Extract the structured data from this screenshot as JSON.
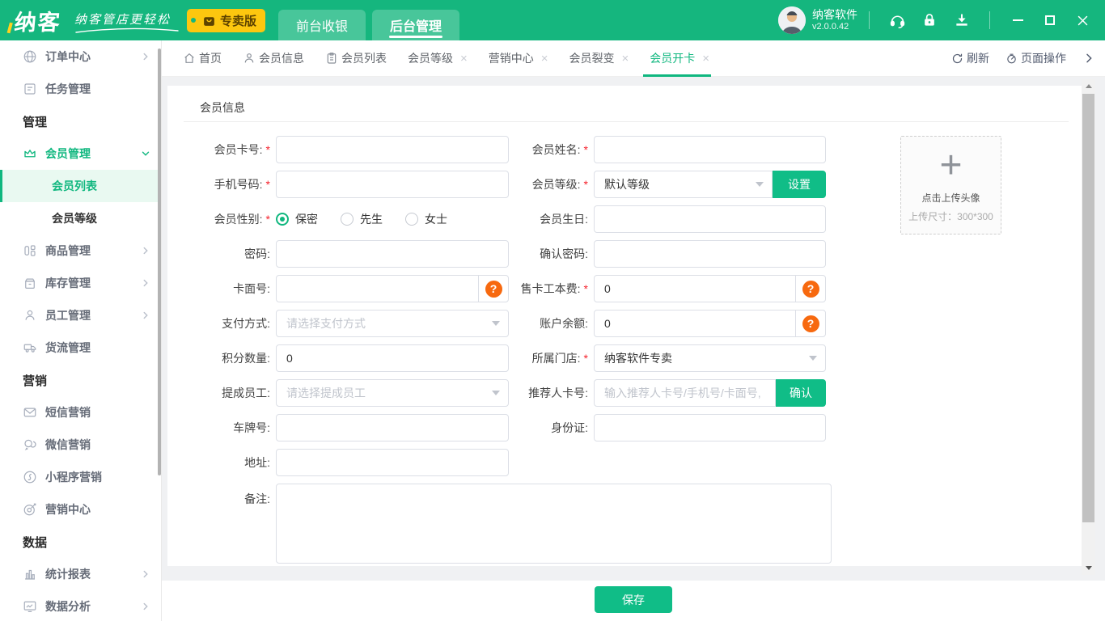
{
  "colors": {
    "header_green": "#15b67e",
    "accent_green": "#10bd87",
    "active_green": "#10b77f",
    "badge_yellow": "#fdc70f",
    "help_orange": "#f7690f",
    "required_red": "#f5222d"
  },
  "header": {
    "logo": "纳客",
    "tagline": "纳客管店更轻松",
    "badge": "专卖版",
    "nav_front": "前台收银",
    "nav_back": "后台管理",
    "user_name": "纳客软件",
    "version": "v2.0.0.42"
  },
  "sidebar": {
    "items": [
      {
        "label": "订单中心"
      },
      {
        "label": "任务管理"
      },
      {
        "label": "管理"
      },
      {
        "label": "会员管理"
      },
      {
        "label": "会员列表"
      },
      {
        "label": "会员等级"
      },
      {
        "label": "商品管理"
      },
      {
        "label": "库存管理"
      },
      {
        "label": "员工管理"
      },
      {
        "label": "货流管理"
      },
      {
        "label": "营销"
      },
      {
        "label": "短信营销"
      },
      {
        "label": "微信营销"
      },
      {
        "label": "小程序营销"
      },
      {
        "label": "营销中心"
      },
      {
        "label": "数据"
      },
      {
        "label": "统计报表"
      },
      {
        "label": "数据分析"
      }
    ]
  },
  "tabs": {
    "items": [
      {
        "label": "首页"
      },
      {
        "label": "会员信息"
      },
      {
        "label": "会员列表"
      },
      {
        "label": "会员等级"
      },
      {
        "label": "营销中心"
      },
      {
        "label": "会员裂变"
      },
      {
        "label": "会员开卡"
      }
    ],
    "refresh": "刷新",
    "page_ops": "页面操作"
  },
  "form": {
    "section_title": "会员信息",
    "required_mark": "*",
    "fields": {
      "card_no": {
        "label": "会员卡号:"
      },
      "name": {
        "label": "会员姓名:"
      },
      "phone": {
        "label": "手机号码:"
      },
      "level": {
        "label": "会员等级:",
        "value": "默认等级",
        "set_button": "设置"
      },
      "gender": {
        "label": "会员性别:",
        "options": [
          "保密",
          "先生",
          "女士"
        ],
        "selected": "保密"
      },
      "birthday": {
        "label": "会员生日:"
      },
      "password": {
        "label": "密码:"
      },
      "confirm_password": {
        "label": "确认密码:"
      },
      "card_face": {
        "label": "卡面号:"
      },
      "card_fee": {
        "label": "售卡工本费:",
        "value": "0"
      },
      "payment": {
        "label": "支付方式:",
        "placeholder": "请选择支付方式"
      },
      "balance": {
        "label": "账户余额:",
        "value": "0"
      },
      "points": {
        "label": "积分数量:",
        "value": "0"
      },
      "store": {
        "label": "所属门店:",
        "value": "纳客软件专卖"
      },
      "commission_staff": {
        "label": "提成员工:",
        "placeholder": "请选择提成员工"
      },
      "referrer": {
        "label": "推荐人卡号:",
        "placeholder": "输入推荐人卡号/手机号/卡面号,",
        "confirm_button": "确认"
      },
      "plate": {
        "label": "车牌号:"
      },
      "id_card": {
        "label": "身份证:"
      },
      "address": {
        "label": "地址:"
      },
      "remark": {
        "label": "备注:"
      }
    },
    "upload": {
      "line1": "点击上传头像",
      "line2": "上传尺寸：300*300"
    },
    "save_button": "保存"
  },
  "icons": {
    "close": "×",
    "plus": "+",
    "help": "?"
  }
}
